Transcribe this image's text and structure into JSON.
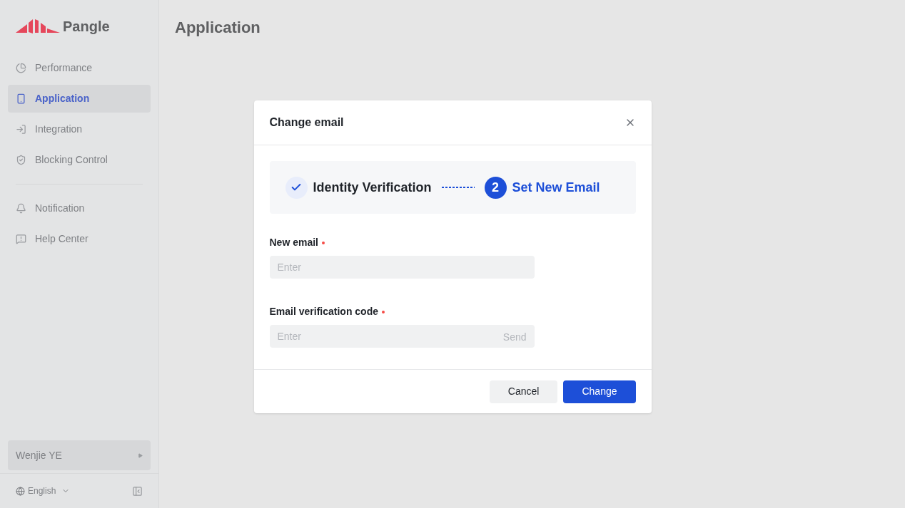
{
  "logo": {
    "text": "Pangle"
  },
  "sidebar": {
    "groups": [
      [
        {
          "label": "Performance",
          "selected": false
        },
        {
          "label": "Application",
          "selected": true
        },
        {
          "label": "Integration",
          "selected": false
        },
        {
          "label": "Blocking Control",
          "selected": false
        }
      ],
      [
        {
          "label": "Notification",
          "selected": false
        },
        {
          "label": "Help Center",
          "selected": false
        }
      ]
    ],
    "user": "Wenjie YE",
    "language": "English"
  },
  "page_title": "Application",
  "dialog": {
    "title": "Change email",
    "steps": [
      {
        "label": "Identity Verification",
        "kind": "done"
      },
      {
        "label": "Set New Email",
        "kind": "current",
        "number": "2"
      }
    ],
    "fields": [
      {
        "label": "New email",
        "required": true,
        "placeholder": "Enter"
      },
      {
        "label": "Email verification code",
        "required": true,
        "placeholder": "Enter",
        "action": "Send"
      }
    ],
    "buttons": [
      {
        "label": "Cancel",
        "kind": "secondary"
      },
      {
        "label": "Change",
        "kind": "primary"
      }
    ]
  }
}
